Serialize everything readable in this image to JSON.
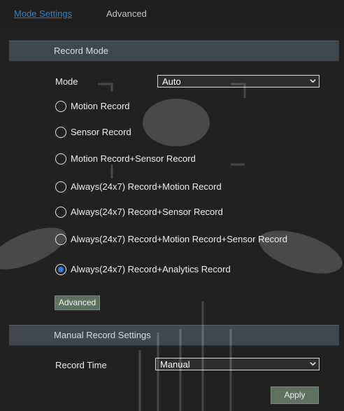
{
  "tabs": [
    {
      "label": "Mode Settings"
    },
    {
      "label": "Advanced"
    }
  ],
  "record_mode": {
    "title": "Record Mode",
    "mode_label": "Mode",
    "mode_value": "Auto",
    "options": [
      {
        "label": "Motion Record",
        "checked": false
      },
      {
        "label": "Sensor Record",
        "checked": false
      },
      {
        "label": "Motion Record+Sensor Record",
        "checked": false
      },
      {
        "label": "Always(24x7) Record+Motion Record",
        "checked": false
      },
      {
        "label": "Always(24x7) Record+Sensor Record",
        "checked": false
      },
      {
        "label": "Always(24x7) Record+Motion Record+Sensor Record",
        "checked": false
      },
      {
        "label": "Always(24x7) Record+Analytics Record",
        "checked": true
      }
    ],
    "advanced_button": "Advanced"
  },
  "manual_settings": {
    "title": "Manual Record Settings",
    "record_time_label": "Record Time",
    "record_time_value": "Manual",
    "apply_button": "Apply"
  },
  "colors": {
    "accent": "#2c7be0",
    "tab_active": "#2f7fd8",
    "header_bar": "#40484f",
    "button_bg": "#5f6f60"
  },
  "icons": {
    "dropdown": "chevron-down-icon",
    "radio": "radio-button-icon"
  }
}
